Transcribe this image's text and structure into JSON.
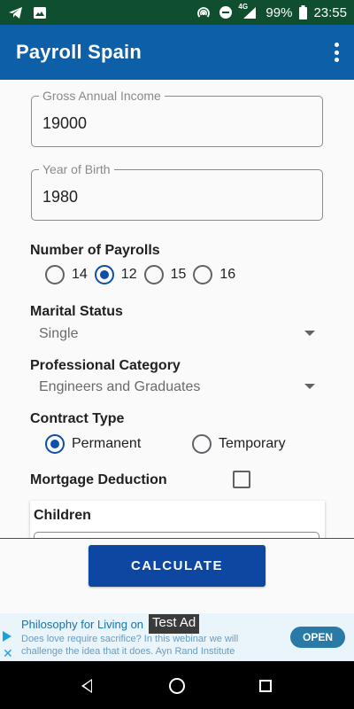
{
  "status_bar": {
    "left_icons": [
      "telegram-icon",
      "image-icon"
    ],
    "right_icons": [
      "hotspot-icon",
      "dnd-icon",
      "signal-4g-icon",
      "battery-icon"
    ],
    "network": "4G",
    "battery": "99%",
    "time": "23:55"
  },
  "app_bar": {
    "title": "Payroll Spain",
    "menu_icon": "more-vert-icon"
  },
  "form": {
    "gross_income": {
      "label": "Gross Annual Income",
      "value": "19000"
    },
    "year_of_birth": {
      "label": "Year of Birth",
      "value": "1980"
    },
    "payrolls": {
      "label": "Number of Payrolls",
      "options": [
        {
          "label": "14",
          "selected": false
        },
        {
          "label": "12",
          "selected": true
        },
        {
          "label": "15",
          "selected": false
        },
        {
          "label": "16",
          "selected": false
        }
      ]
    },
    "marital_status": {
      "label": "Marital Status",
      "value": "Single"
    },
    "professional_category": {
      "label": "Professional Category",
      "value": "Engineers and Graduates"
    },
    "contract_type": {
      "label": "Contract Type",
      "options": [
        {
          "label": "Permanent",
          "selected": true
        },
        {
          "label": "Temporary",
          "selected": false
        }
      ]
    },
    "mortgage": {
      "label": "Mortgage Deduction",
      "checked": false
    },
    "children": {
      "label": "Children"
    }
  },
  "calculate_label": "CALCULATE",
  "ad": {
    "title": "Philosophy for Living on",
    "badge": "Test Ad",
    "body": "Does love require sacrifice? In this webinar we will challenge the idea that it does. Ayn Rand Institute",
    "open_label": "OPEN",
    "close_glyph": "✕"
  },
  "colors": {
    "status_bar": "#0f4f2f",
    "app_bar": "#0d5fa8",
    "accent": "#0d4ea6",
    "button": "#0d47a1"
  }
}
